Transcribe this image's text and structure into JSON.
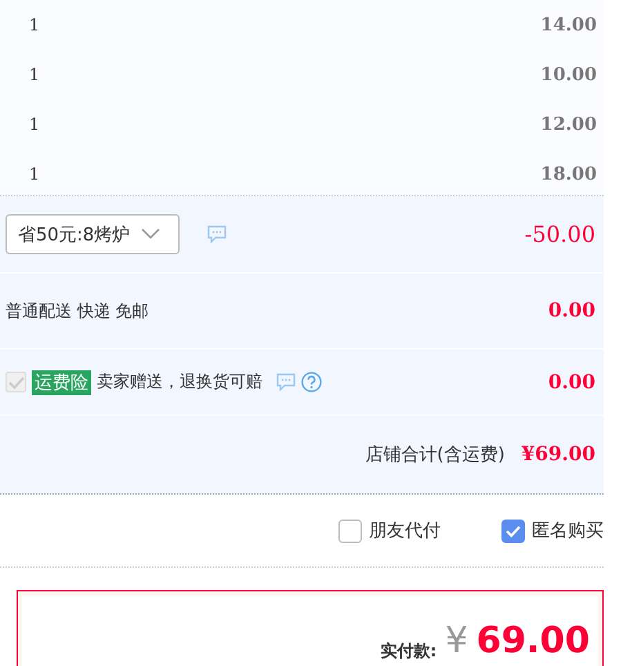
{
  "items": [
    {
      "quantity": "1",
      "subtotal": "14.00"
    },
    {
      "quantity": "1",
      "subtotal": "10.00"
    },
    {
      "quantity": "1",
      "subtotal": "12.00"
    },
    {
      "quantity": "1",
      "subtotal": "18.00"
    }
  ],
  "promotion": {
    "value": "省50元:8烤炉",
    "amount": "-50.00"
  },
  "delivery": {
    "label": "普通配送 快递 免邮",
    "amount": "0.00"
  },
  "insurance": {
    "checked": true,
    "disabled": true,
    "tag": "运费险",
    "label": "卖家赠送，退换货可赔",
    "amount": "0.00"
  },
  "shop_total": {
    "label": "店铺合计(含运费)",
    "amount": "¥69.00"
  },
  "options": [
    {
      "label": "朋友代付",
      "checked": false
    },
    {
      "label": "匿名购买",
      "checked": true
    }
  ],
  "payment": {
    "label": "实付款:",
    "currency": "¥",
    "amount": "69.00"
  }
}
